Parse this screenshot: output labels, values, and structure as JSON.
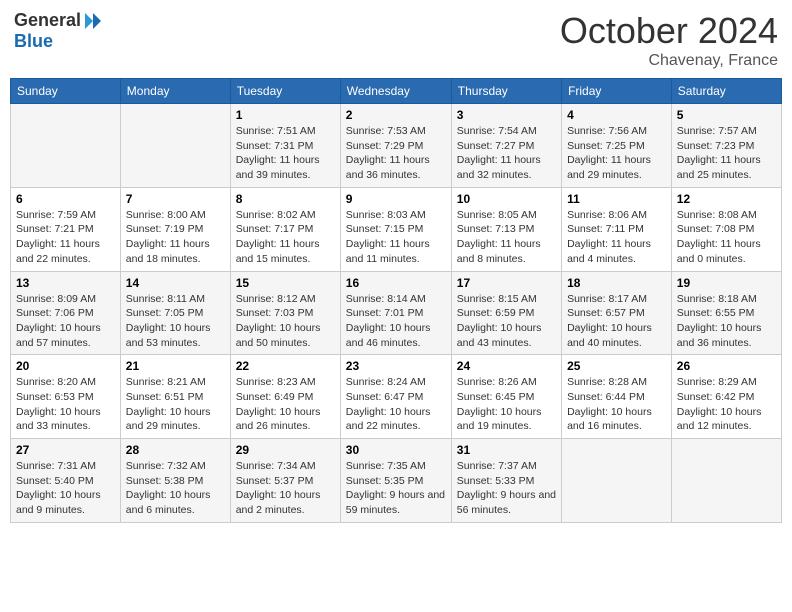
{
  "header": {
    "logo_general": "General",
    "logo_blue": "Blue",
    "month_year": "October 2024",
    "location": "Chavenay, France"
  },
  "weekdays": [
    "Sunday",
    "Monday",
    "Tuesday",
    "Wednesday",
    "Thursday",
    "Friday",
    "Saturday"
  ],
  "rows": [
    [
      {
        "day": "",
        "info": ""
      },
      {
        "day": "",
        "info": ""
      },
      {
        "day": "1",
        "info": "Sunrise: 7:51 AM\nSunset: 7:31 PM\nDaylight: 11 hours and 39 minutes."
      },
      {
        "day": "2",
        "info": "Sunrise: 7:53 AM\nSunset: 7:29 PM\nDaylight: 11 hours and 36 minutes."
      },
      {
        "day": "3",
        "info": "Sunrise: 7:54 AM\nSunset: 7:27 PM\nDaylight: 11 hours and 32 minutes."
      },
      {
        "day": "4",
        "info": "Sunrise: 7:56 AM\nSunset: 7:25 PM\nDaylight: 11 hours and 29 minutes."
      },
      {
        "day": "5",
        "info": "Sunrise: 7:57 AM\nSunset: 7:23 PM\nDaylight: 11 hours and 25 minutes."
      }
    ],
    [
      {
        "day": "6",
        "info": "Sunrise: 7:59 AM\nSunset: 7:21 PM\nDaylight: 11 hours and 22 minutes."
      },
      {
        "day": "7",
        "info": "Sunrise: 8:00 AM\nSunset: 7:19 PM\nDaylight: 11 hours and 18 minutes."
      },
      {
        "day": "8",
        "info": "Sunrise: 8:02 AM\nSunset: 7:17 PM\nDaylight: 11 hours and 15 minutes."
      },
      {
        "day": "9",
        "info": "Sunrise: 8:03 AM\nSunset: 7:15 PM\nDaylight: 11 hours and 11 minutes."
      },
      {
        "day": "10",
        "info": "Sunrise: 8:05 AM\nSunset: 7:13 PM\nDaylight: 11 hours and 8 minutes."
      },
      {
        "day": "11",
        "info": "Sunrise: 8:06 AM\nSunset: 7:11 PM\nDaylight: 11 hours and 4 minutes."
      },
      {
        "day": "12",
        "info": "Sunrise: 8:08 AM\nSunset: 7:08 PM\nDaylight: 11 hours and 0 minutes."
      }
    ],
    [
      {
        "day": "13",
        "info": "Sunrise: 8:09 AM\nSunset: 7:06 PM\nDaylight: 10 hours and 57 minutes."
      },
      {
        "day": "14",
        "info": "Sunrise: 8:11 AM\nSunset: 7:05 PM\nDaylight: 10 hours and 53 minutes."
      },
      {
        "day": "15",
        "info": "Sunrise: 8:12 AM\nSunset: 7:03 PM\nDaylight: 10 hours and 50 minutes."
      },
      {
        "day": "16",
        "info": "Sunrise: 8:14 AM\nSunset: 7:01 PM\nDaylight: 10 hours and 46 minutes."
      },
      {
        "day": "17",
        "info": "Sunrise: 8:15 AM\nSunset: 6:59 PM\nDaylight: 10 hours and 43 minutes."
      },
      {
        "day": "18",
        "info": "Sunrise: 8:17 AM\nSunset: 6:57 PM\nDaylight: 10 hours and 40 minutes."
      },
      {
        "day": "19",
        "info": "Sunrise: 8:18 AM\nSunset: 6:55 PM\nDaylight: 10 hours and 36 minutes."
      }
    ],
    [
      {
        "day": "20",
        "info": "Sunrise: 8:20 AM\nSunset: 6:53 PM\nDaylight: 10 hours and 33 minutes."
      },
      {
        "day": "21",
        "info": "Sunrise: 8:21 AM\nSunset: 6:51 PM\nDaylight: 10 hours and 29 minutes."
      },
      {
        "day": "22",
        "info": "Sunrise: 8:23 AM\nSunset: 6:49 PM\nDaylight: 10 hours and 26 minutes."
      },
      {
        "day": "23",
        "info": "Sunrise: 8:24 AM\nSunset: 6:47 PM\nDaylight: 10 hours and 22 minutes."
      },
      {
        "day": "24",
        "info": "Sunrise: 8:26 AM\nSunset: 6:45 PM\nDaylight: 10 hours and 19 minutes."
      },
      {
        "day": "25",
        "info": "Sunrise: 8:28 AM\nSunset: 6:44 PM\nDaylight: 10 hours and 16 minutes."
      },
      {
        "day": "26",
        "info": "Sunrise: 8:29 AM\nSunset: 6:42 PM\nDaylight: 10 hours and 12 minutes."
      }
    ],
    [
      {
        "day": "27",
        "info": "Sunrise: 7:31 AM\nSunset: 5:40 PM\nDaylight: 10 hours and 9 minutes."
      },
      {
        "day": "28",
        "info": "Sunrise: 7:32 AM\nSunset: 5:38 PM\nDaylight: 10 hours and 6 minutes."
      },
      {
        "day": "29",
        "info": "Sunrise: 7:34 AM\nSunset: 5:37 PM\nDaylight: 10 hours and 2 minutes."
      },
      {
        "day": "30",
        "info": "Sunrise: 7:35 AM\nSunset: 5:35 PM\nDaylight: 9 hours and 59 minutes."
      },
      {
        "day": "31",
        "info": "Sunrise: 7:37 AM\nSunset: 5:33 PM\nDaylight: 9 hours and 56 minutes."
      },
      {
        "day": "",
        "info": ""
      },
      {
        "day": "",
        "info": ""
      }
    ]
  ]
}
